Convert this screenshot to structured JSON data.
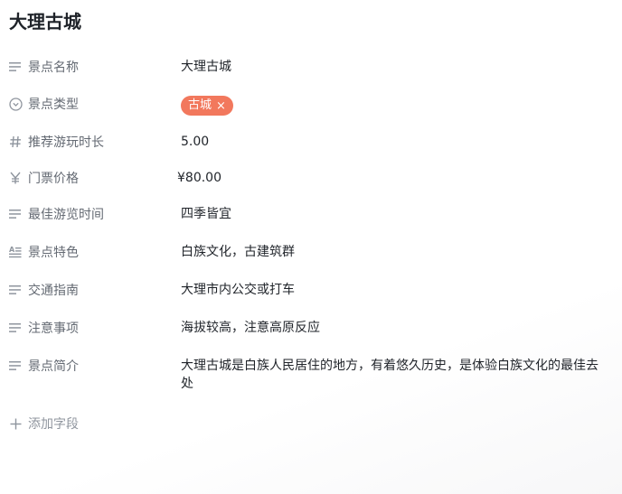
{
  "title": "大理古城",
  "fields": [
    {
      "label": "景点名称",
      "icon": "text-lines-icon",
      "value": "大理古城"
    },
    {
      "label": "景点类型",
      "icon": "chevron-circle-icon",
      "tag": "古城",
      "tag_close": "×"
    },
    {
      "label": "推荐游玩时长",
      "icon": "hash-icon",
      "value": "5.00"
    },
    {
      "label": "门票价格",
      "icon": "yen-icon",
      "value": "¥80.00"
    },
    {
      "label": "最佳游览时间",
      "icon": "text-lines-icon",
      "value": "四季皆宜"
    },
    {
      "label": "景点特色",
      "icon": "text-format-icon",
      "value": "白族文化，古建筑群"
    },
    {
      "label": "交通指南",
      "icon": "text-lines-icon",
      "value": "大理市内公交或打车"
    },
    {
      "label": "注意事项",
      "icon": "text-lines-icon",
      "value": "海拔较高，注意高原反应"
    },
    {
      "label": "景点简介",
      "icon": "text-lines-icon",
      "value": "大理古城是白族人民居住的地方，有着悠久历史，是体验白族文化的最佳去处"
    }
  ],
  "add_field": {
    "label": "添加字段",
    "icon": "plus-icon"
  },
  "colors": {
    "tag_bg": "#f2785d",
    "label": "#646a73",
    "value": "#1f2329",
    "muted": "#8f959e"
  }
}
